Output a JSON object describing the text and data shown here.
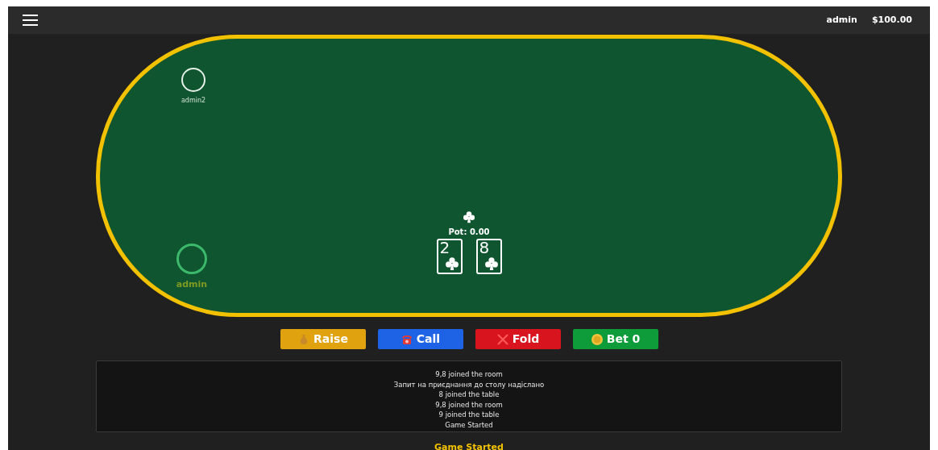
{
  "header": {
    "username": "admin",
    "balance": "$100.00"
  },
  "table": {
    "seats": [
      {
        "name": "admin2",
        "active": false
      },
      {
        "name": "admin",
        "active": true
      }
    ],
    "pot": "Pot: 0.00",
    "cards": [
      {
        "rank": "2",
        "kind": "club"
      },
      {
        "rank": "8",
        "kind": "club"
      }
    ]
  },
  "actions": [
    {
      "kind": "raise",
      "label": "Raise"
    },
    {
      "kind": "call",
      "label": "Call"
    },
    {
      "kind": "fold",
      "label": "Fold"
    },
    {
      "kind": "bet",
      "label": "Bet 0"
    }
  ],
  "log": [
    "9,8 joined the room",
    "Запит на приєднання до столу надіслано",
    "8 joined the table",
    "9,8 joined the room",
    "9 joined the table",
    "Game Started"
  ],
  "status": "Game Started"
}
